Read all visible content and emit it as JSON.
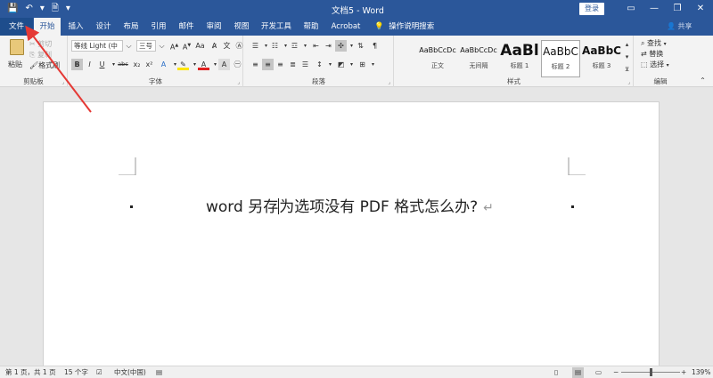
{
  "window": {
    "title": "文档5 - Word",
    "login": "登录",
    "controls": [
      "▭",
      "—",
      "❐",
      "✕"
    ]
  },
  "qat": [
    "💾",
    "↶",
    "▾",
    "🗎",
    "▾"
  ],
  "tabs": [
    {
      "label": "文件"
    },
    {
      "label": "开始"
    },
    {
      "label": "插入"
    },
    {
      "label": "设计"
    },
    {
      "label": "布局"
    },
    {
      "label": "引用"
    },
    {
      "label": "邮件"
    },
    {
      "label": "审阅"
    },
    {
      "label": "视图"
    },
    {
      "label": "开发工具"
    },
    {
      "label": "帮助"
    },
    {
      "label": "Acrobat"
    }
  ],
  "tell_me": "操作说明搜索",
  "share": "共享",
  "ribbon": {
    "clipboard": {
      "label": "剪贴板",
      "paste": "粘贴",
      "cut": "剪切",
      "copy": "复制",
      "format_painter": "格式刷"
    },
    "font": {
      "label": "字体",
      "font_name": "等线 Light (中",
      "font_size": "三号",
      "bold": "B",
      "italic": "I",
      "underline": "U",
      "strike": "abc",
      "subscript": "x₂",
      "superscript": "x²"
    },
    "paragraph": {
      "label": "段落"
    },
    "styles": {
      "label": "样式",
      "items": [
        {
          "sample": "AaBbCcDc",
          "name": "正文"
        },
        {
          "sample": "AaBbCcDc",
          "name": "无间隔"
        },
        {
          "sample": "AaBl",
          "name": "标题 1"
        },
        {
          "sample": "AaBbC",
          "name": "标题 2"
        },
        {
          "sample": "AaBbC",
          "name": "标题 3"
        }
      ]
    },
    "editing": {
      "label": "编辑",
      "find": "查找",
      "replace": "替换",
      "select": "选择"
    }
  },
  "document": {
    "text_before_caret": "word 另存",
    "text_after_caret": "为选项没有 PDF 格式怎么办?",
    "para_mark": "↵"
  },
  "status": {
    "page": "第 1 页，共 1 页",
    "words": "15 个字",
    "language": "中文(中国)",
    "zoom": "139%"
  },
  "colors": {
    "title_bar": "#2b579a",
    "ribbon_bg": "#f3f3f3",
    "arrow": "#e53935"
  }
}
